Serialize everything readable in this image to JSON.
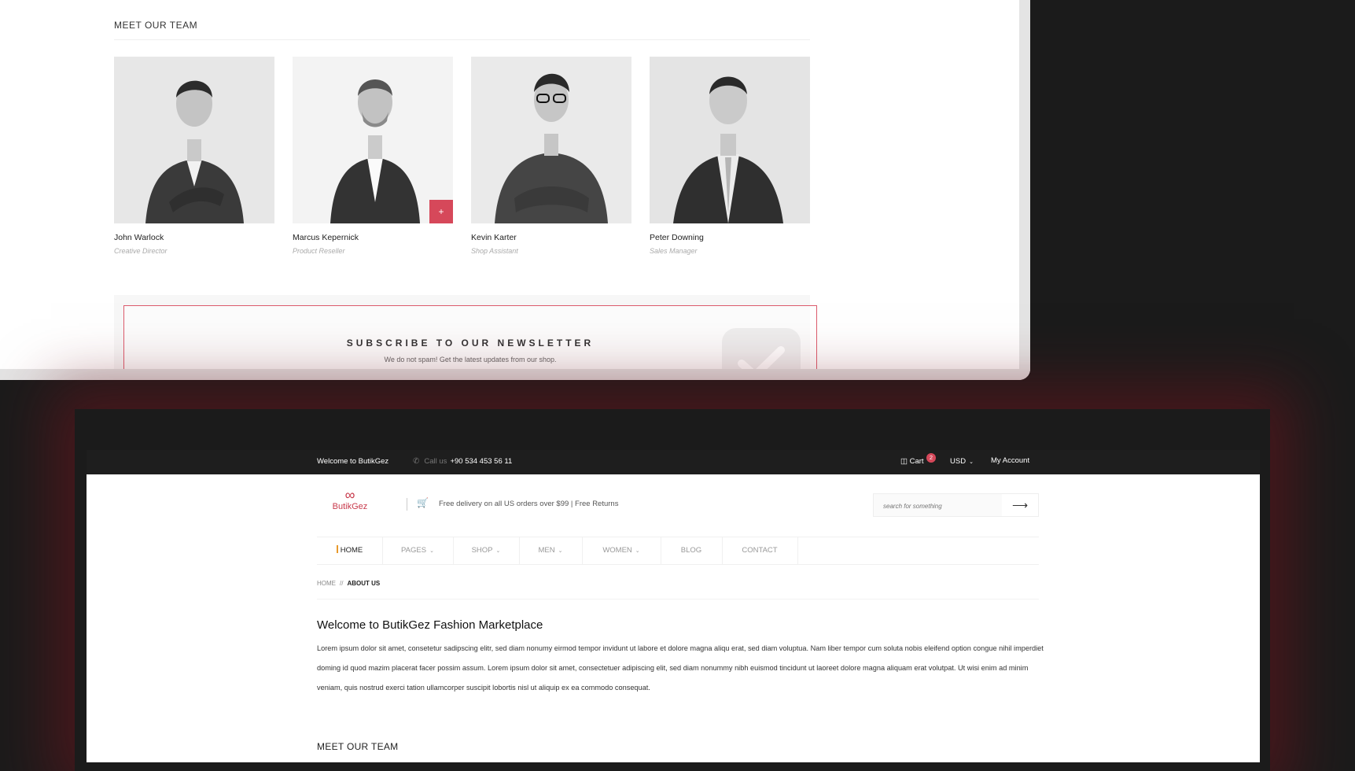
{
  "top_window": {
    "section_title": "MEET OUR TEAM",
    "members": [
      {
        "name": "John Warlock",
        "role": "Creative Director"
      },
      {
        "name": "Marcus Kepernick",
        "role": "Product Reseller"
      },
      {
        "name": "Kevin Karter",
        "role": "Shop Assistant"
      },
      {
        "name": "Peter Downing",
        "role": "Sales Manager"
      }
    ],
    "plus_label": "+",
    "newsletter": {
      "title": "SUBSCRIBE TO OUR NEWSLETTER",
      "subtitle": "We do not spam! Get the latest updates from our shop."
    }
  },
  "topbar": {
    "welcome": "Welcome to ButikGez",
    "call_label": "Call us",
    "phone": "+90 534 453 56 11",
    "cart_label": "Cart",
    "cart_count": "2",
    "currency": "USD",
    "account": "My Account"
  },
  "header": {
    "logo_text": "ButikGez",
    "promo": "Free delivery on all US orders over $99 | Free Returns",
    "search_placeholder": "search for something"
  },
  "nav": {
    "items": [
      {
        "label": "HOME",
        "dropdown": false
      },
      {
        "label": "PAGES",
        "dropdown": true
      },
      {
        "label": "SHOP",
        "dropdown": true
      },
      {
        "label": "MEN",
        "dropdown": true
      },
      {
        "label": "WOMEN",
        "dropdown": true
      },
      {
        "label": "BLOG",
        "dropdown": false
      },
      {
        "label": "CONTACT",
        "dropdown": false
      }
    ]
  },
  "breadcrumb": {
    "home": "HOME",
    "separator": "//",
    "current": "ABOUT US"
  },
  "content": {
    "title": "Welcome to ButikGez Fashion Marketplace",
    "paragraph": "Lorem ipsum dolor sit amet, consetetur sadipscing elitr, sed diam nonumy eirmod tempor invidunt ut labore et dolore magna aliqu erat, sed diam voluptua. Nam liber tempor cum soluta nobis eleifend option congue nihil imperdiet doming id quod mazim placerat facer possim assum. Lorem ipsum dolor sit amet, consectetuer adipiscing elit, sed diam nonummy nibh euismod tincidunt ut laoreet dolore magna aliquam erat volutpat. Ut wisi enim ad minim veniam, quis nostrud exerci tation ullamcorper suscipit lobortis nisl ut aliquip ex ea commodo consequat.",
    "team_title": "MEET OUR TEAM"
  },
  "colors": {
    "accent": "#d6485a",
    "topbar": "#1e1e1e",
    "nav_active_marker": "#e89a2c"
  },
  "icons": [
    "phone-icon",
    "cart-icon",
    "chevron-down-icon",
    "arrow-right-icon",
    "logo-icon",
    "plus-icon",
    "check-icon"
  ]
}
